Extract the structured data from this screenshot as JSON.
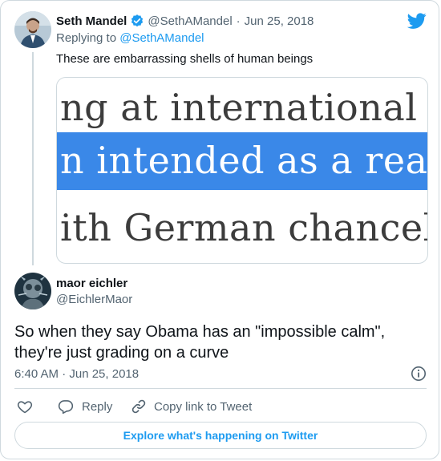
{
  "parent_tweet": {
    "name": "Seth Mandel",
    "handle": "@SethAMandel",
    "separator": "·",
    "date": "Jun 25, 2018",
    "replying_prefix": "Replying to",
    "replying_to": "@SethAMandel",
    "text": "These are embarrassing shells of human beings",
    "image_lines": [
      "ng at international di",
      "n intended as a reassu",
      "ith German chancello"
    ]
  },
  "main_tweet": {
    "name": "maor eichler",
    "handle": "@EichlerMaor",
    "text_line1": "So when they say Obama has an \"impossible calm\",",
    "text_line2": "they're just grading on a curve",
    "timestamp": "6:40 AM · Jun 25, 2018"
  },
  "actions": {
    "reply_label": "Reply",
    "copy_label": "Copy link to Tweet"
  },
  "explore_label": "Explore what's happening on Twitter",
  "icons": {
    "twitter": "twitter-bird-icon",
    "verified": "verified-badge-icon",
    "info": "info-icon",
    "like": "heart-icon",
    "reply": "reply-icon",
    "copy": "link-icon"
  },
  "colors": {
    "accent": "#1d9bf0",
    "text": "#0f1419",
    "muted": "#536471",
    "border": "#cfd9de",
    "highlight": "#3a88e8"
  }
}
